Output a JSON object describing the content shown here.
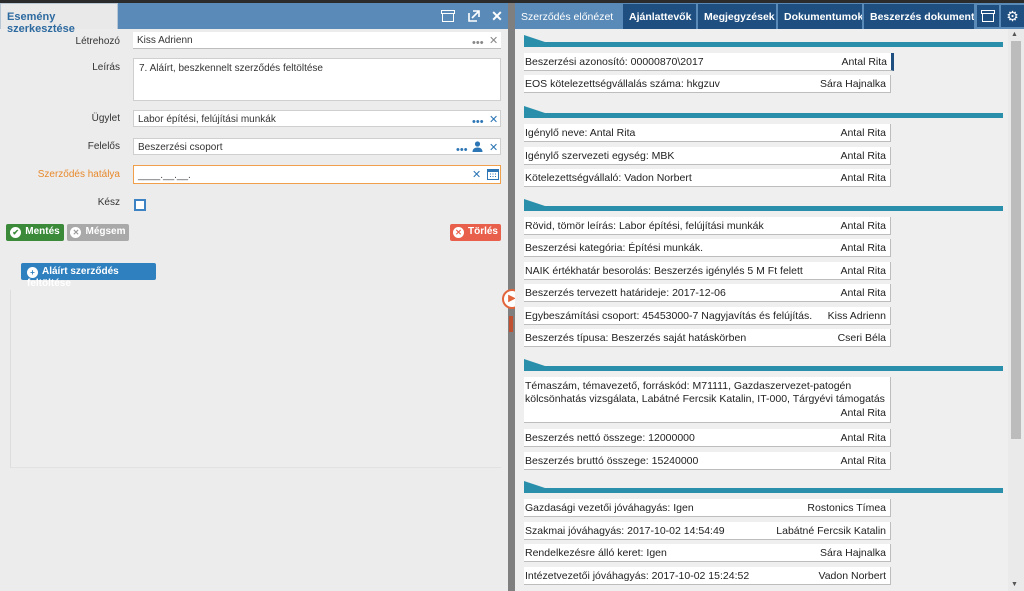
{
  "left": {
    "title": "Esemény szerkesztése",
    "fields": {
      "letrehozo_label": "Létrehozó",
      "letrehozo_value": "Kiss Adrienn",
      "leiras_label": "Leírás",
      "leiras_value": "7. Aláírt, beszkennelt szerződés feltöltése",
      "ugylet_label": "Ügylet",
      "ugylet_value": "Labor építési, felújítási munkák",
      "felelos_label": "Felelős",
      "felelos_value": "Beszerzési csoport",
      "hataly_label": "Szerződés hatálya",
      "hataly_placeholder": "____.__.__.",
      "kesz_label": "Kész"
    },
    "buttons": {
      "save": "Mentés",
      "cancel": "Mégsem",
      "delete": "Törlés",
      "upload": "Aláírt szerződés feltöltése"
    }
  },
  "right": {
    "tabs": [
      "Szerződés előnézet",
      "Ajánlattevők",
      "Megjegyzések",
      "Dokumentumok",
      "Beszerzés dokumentumai"
    ],
    "groups": [
      {
        "rows": [
          {
            "label": "Beszerzési azonosító: 00000870\\2017",
            "person": "Antal Rita"
          },
          {
            "label": "EOS kötelezettségvállalás száma: hkgzuv",
            "person": "Sára Hajnalka"
          }
        ]
      },
      {
        "rows": [
          {
            "label": "Igénylő neve: Antal Rita",
            "person": "Antal Rita"
          },
          {
            "label": "Igénylő szervezeti egység: MBK",
            "person": "Antal Rita"
          },
          {
            "label": "Kötelezettségvállaló: Vadon Norbert",
            "person": "Antal Rita"
          }
        ]
      },
      {
        "rows": [
          {
            "label": "Rövid, tömör leírás: Labor építési, felújítási munkák",
            "person": "Antal Rita"
          },
          {
            "label": "Beszerzési kategória: Építési munkák.",
            "person": "Antal Rita"
          },
          {
            "label": "NAIK értékhatár besorolás: Beszerzés igénylés 5 M Ft felett",
            "person": "Antal Rita"
          },
          {
            "label": "Beszerzés tervezett határideje: 2017-12-06",
            "person": "Antal Rita"
          },
          {
            "label": "Egybeszámítási csoport: 45453000-7 Nagyjavítás és felújítás.",
            "person": "Kiss Adrienn"
          },
          {
            "label": "Beszerzés típusa: Beszerzés saját hatáskörben",
            "person": "Cseri Béla"
          }
        ]
      },
      {
        "rows": [
          {
            "label": "Témaszám, témavezető, forráskód: M71111, Gazdaszervezet-patogén",
            "label2": "kölcsönhatás vizsgálata, Labátné Fercsik Katalin, IT-000, Tárgyévi támogatás",
            "person": "Antal Rita"
          },
          {
            "label": "Beszerzés nettó összege: 12000000",
            "person": "Antal Rita"
          },
          {
            "label": "Beszerzés bruttó összege: 15240000",
            "person": "Antal Rita"
          }
        ]
      },
      {
        "rows": [
          {
            "label": "Gazdasági vezetői jóváhagyás: Igen",
            "person": "Rostonics Tímea"
          },
          {
            "label": "Szakmai jóváhagyás: 2017-10-02 14:54:49",
            "person": "Labátné Fercsik Katalin"
          },
          {
            "label": "Rendelkezésre álló keret: Igen",
            "person": "Sára Hajnalka"
          },
          {
            "label": "Intézetvezetői jóváhagyás: 2017-10-02 15:24:52",
            "person": "Vadon Norbert"
          }
        ]
      }
    ]
  },
  "colors": {
    "accent": "#2a8fab",
    "header": "#5a8bb8",
    "tab_dark": "#1f4f80",
    "save": "#3a8a3a",
    "delete": "#e8604c"
  }
}
